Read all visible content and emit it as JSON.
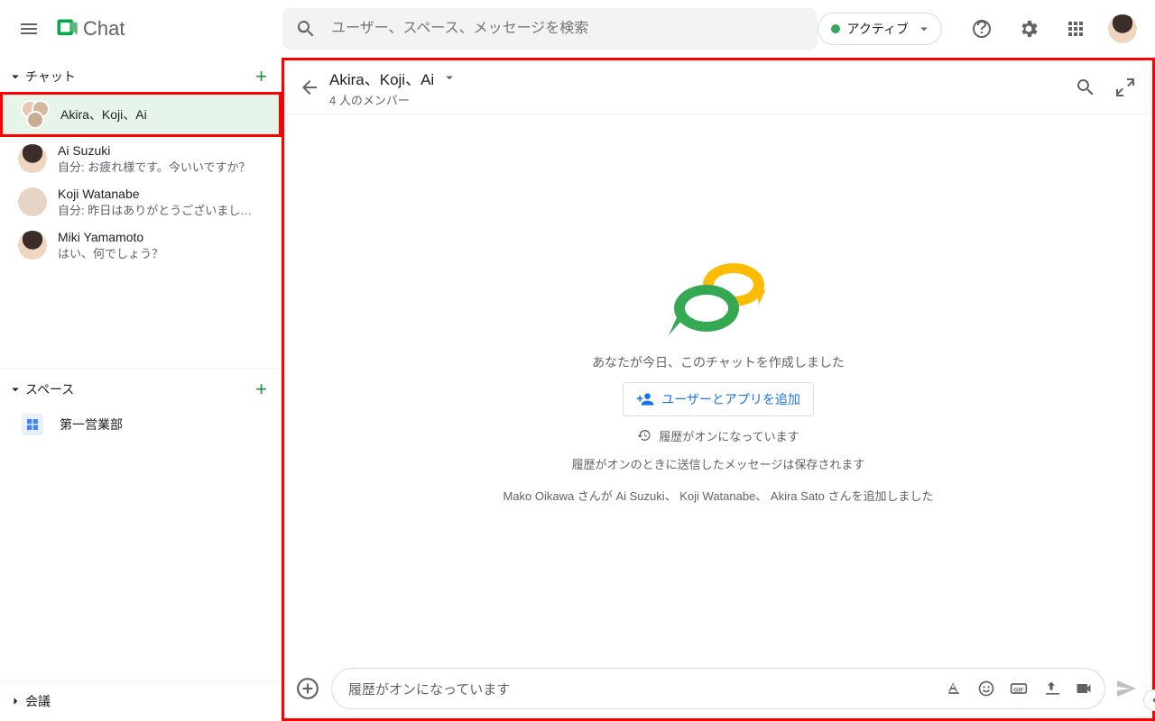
{
  "app": {
    "title": "Chat"
  },
  "search": {
    "placeholder": "ユーザー、スペース、メッセージを検索"
  },
  "status": {
    "label": "アクティブ"
  },
  "sidebar": {
    "chats": {
      "label": "チャット",
      "items": [
        {
          "name": "Akira、Koji、Ai",
          "preview": ""
        },
        {
          "name": "Ai Suzuki",
          "preview": "自分: お疲れ様です。今いいですか？"
        },
        {
          "name": "Koji Watanabe",
          "preview": "自分: 昨日はありがとうございました…"
        },
        {
          "name": "Miki Yamamoto",
          "preview": "はい、何でしょう？"
        }
      ]
    },
    "spaces": {
      "label": "スペース",
      "items": [
        {
          "name": "第一営業部"
        }
      ]
    },
    "meetings": {
      "label": "会議"
    }
  },
  "conversation": {
    "title": "Akira、Koji、Ai",
    "subtitle": "4 人のメンバー",
    "created_text": "あなたが今日、このチャットを作成しました",
    "add_users_label": "ユーザーとアプリを追加",
    "history_on": "履歴がオンになっています",
    "history_note": "履歴がオンのときに送信したメッセージは保存されます",
    "added_line": "Mako Oikawa さんが Ai Suzuki、 Koji Watanabe、 Akira Sato さんを追加しました",
    "composer_placeholder": "履歴がオンになっています"
  }
}
